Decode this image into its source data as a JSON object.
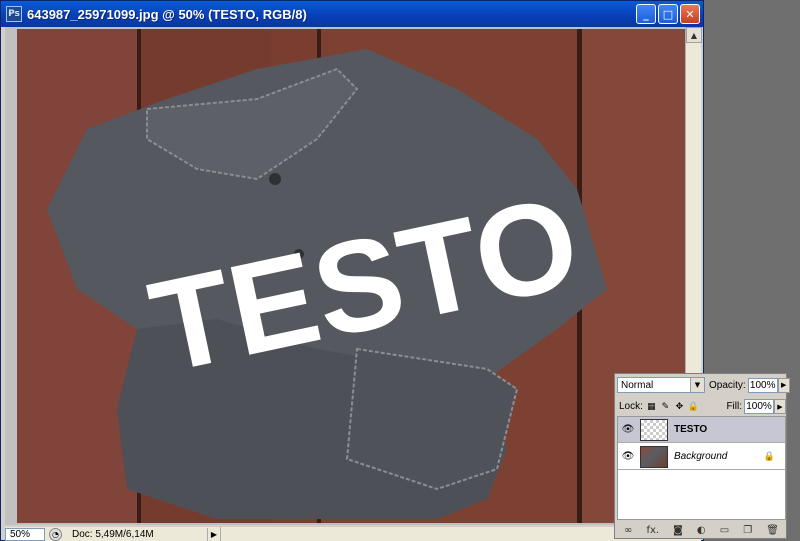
{
  "window": {
    "app_icon": "Ps",
    "title": "643987_25971099.jpg @ 50% (TESTO, RGB/8)",
    "buttons": {
      "minimize": "_",
      "maximize": "□",
      "close": "✕"
    }
  },
  "canvas": {
    "overlay_text": "TESTO",
    "colors": {
      "wood": "#7a3e30",
      "shirt": "#55585e",
      "text": "#ffffff"
    }
  },
  "status": {
    "zoom": "50%",
    "doc_info": "Doc: 5,49M/6,14M",
    "arrow": "▶"
  },
  "layers_panel": {
    "blend_mode": "Normal",
    "opacity_label": "Opacity:",
    "opacity_value": "100%",
    "lock_label": "Lock:",
    "fill_label": "Fill:",
    "fill_value": "100%",
    "layers": [
      {
        "name": "TESTO",
        "selected": true,
        "type": "text"
      },
      {
        "name": "Background",
        "selected": false,
        "locked": true
      }
    ],
    "bottom_icons": [
      "link-icon",
      "fx-icon",
      "mask-icon",
      "adjustment-icon",
      "folder-icon",
      "new-layer-icon",
      "trash-icon"
    ],
    "fx_label": "fx."
  }
}
